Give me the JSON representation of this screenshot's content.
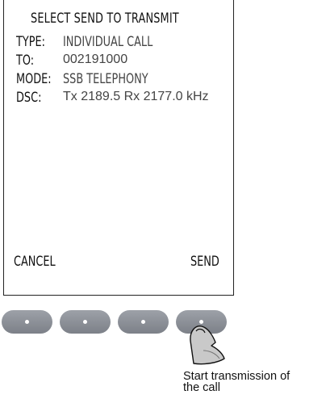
{
  "screen": {
    "title": "SELECT SEND TO TRANSMIT",
    "fields": [
      {
        "label": "TYPE:",
        "value": "INDIVIDUAL CALL"
      },
      {
        "label": "TO:",
        "value": "002191000"
      },
      {
        "label": "MODE:",
        "value": "SSB TELEPHONY"
      },
      {
        "label": "DSC:",
        "value": "Tx 2189.5 Rx 2177.0 kHz"
      }
    ],
    "softkeys": {
      "left": "CANCEL",
      "right": "SEND"
    }
  },
  "buttons": [
    {
      "id": "softkey-1",
      "icon": "dot-icon"
    },
    {
      "id": "softkey-2",
      "icon": "dot-icon"
    },
    {
      "id": "softkey-3",
      "icon": "dot-icon"
    },
    {
      "id": "softkey-4",
      "icon": "dot-icon",
      "pressed": true
    }
  ],
  "caption": {
    "line1": "Start transmission of",
    "line2": "the call"
  },
  "colors": {
    "button": "#8b8f96",
    "text": "#111111",
    "value_text": "#444444"
  }
}
